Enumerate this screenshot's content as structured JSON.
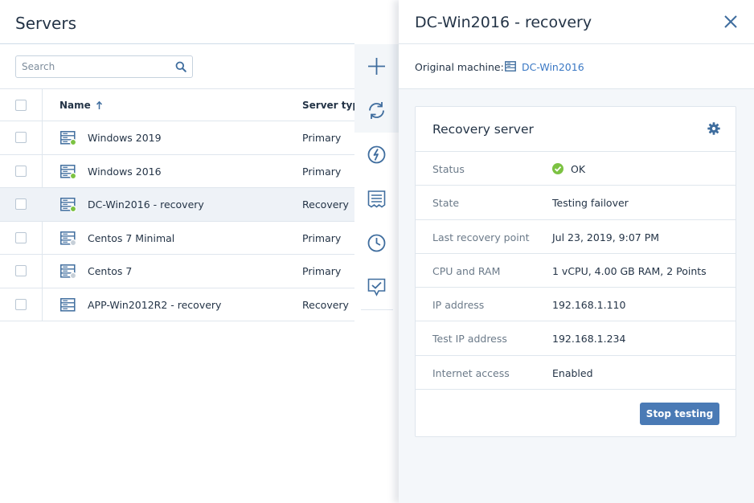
{
  "list": {
    "title": "Servers",
    "search_placeholder": "Search",
    "columns": {
      "name": "Name",
      "type": "Server type"
    },
    "rows": [
      {
        "name": "Windows 2019",
        "type": "Primary",
        "status": "online"
      },
      {
        "name": "Windows 2016",
        "type": "Primary",
        "status": "online"
      },
      {
        "name": "DC-Win2016 - recovery",
        "type": "Recovery",
        "status": "online",
        "selected": true
      },
      {
        "name": "Centos 7 Minimal",
        "type": "Primary",
        "status": "offline"
      },
      {
        "name": "Centos 7",
        "type": "Primary",
        "status": "offline"
      },
      {
        "name": "APP-Win2012R2 - recovery",
        "type": "Recovery",
        "status": "none"
      }
    ]
  },
  "actions": [
    "add-icon",
    "refresh-icon",
    "power-icon",
    "log-icon",
    "history-icon",
    "test-icon"
  ],
  "panel": {
    "title": "DC-Win2016 - recovery",
    "original_label": "Original machine:",
    "original_link": "DC-Win2016",
    "card_title": "Recovery server",
    "props": [
      {
        "label": "Status",
        "value": "OK"
      },
      {
        "label": "State",
        "value": "Testing failover"
      },
      {
        "label": "Last recovery point",
        "value": "Jul 23, 2019, 9:07 PM"
      },
      {
        "label": "CPU and RAM",
        "value": "1 vCPU, 4.00 GB RAM, 2 Points"
      },
      {
        "label": "IP address",
        "value": "192.168.1.110"
      },
      {
        "label": "Test IP address",
        "value": "192.168.1.234"
      },
      {
        "label": "Internet access",
        "value": "Enabled"
      }
    ],
    "stop_button": "Stop testing"
  },
  "colors": {
    "accent": "#4a7ab5",
    "link": "#3a78c4",
    "status_online": "#7cc242",
    "status_offline": "#c6cfd8",
    "ok_green": "#7cc242"
  }
}
